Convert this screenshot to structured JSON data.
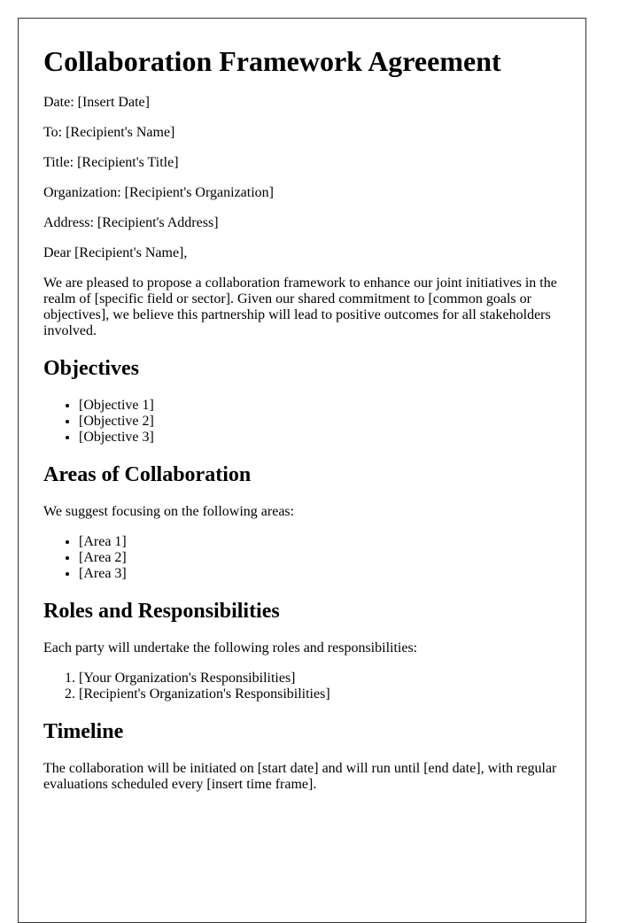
{
  "document": {
    "title": "Collaboration Framework Agreement",
    "header_fields": [
      {
        "text": "Date: [Insert Date]"
      },
      {
        "text": "To: [Recipient's Name]"
      },
      {
        "text": "Title: [Recipient's Title]"
      },
      {
        "text": "Organization: [Recipient's Organization]"
      },
      {
        "text": "Address: [Recipient's Address]"
      }
    ],
    "salutation": "Dear [Recipient's Name],",
    "intro": "We are pleased to propose a collaboration framework to enhance our joint initiatives in the realm of [specific field or sector]. Given our shared commitment to [common goals or objectives], we believe this partnership will lead to positive outcomes for all stakeholders involved.",
    "sections": {
      "objectives": {
        "heading": "Objectives",
        "items": [
          "[Objective 1]",
          "[Objective 2]",
          "[Objective 3]"
        ]
      },
      "areas": {
        "heading": "Areas of Collaboration",
        "intro": "We suggest focusing on the following areas:",
        "items": [
          "[Area 1]",
          "[Area 2]",
          "[Area 3]"
        ]
      },
      "roles": {
        "heading": "Roles and Responsibilities",
        "intro": "Each party will undertake the following roles and responsibilities:",
        "items": [
          "[Your Organization's Responsibilities]",
          "[Recipient's Organization's Responsibilities]"
        ]
      },
      "timeline": {
        "heading": "Timeline",
        "text": "The collaboration will be initiated on [start date] and will run until [end date], with regular evaluations scheduled every [insert time frame]."
      }
    }
  }
}
